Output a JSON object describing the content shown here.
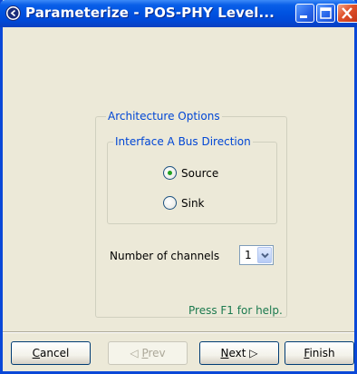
{
  "window": {
    "title": "Parameterize - POS-PHY Level..."
  },
  "titlebar": {
    "buttons": [
      {
        "name": "minimize",
        "icon": "minimize-icon"
      },
      {
        "name": "maximize",
        "icon": "maximize-icon"
      },
      {
        "name": "close",
        "icon": "close-icon"
      }
    ],
    "app_icon": "app-icon"
  },
  "architecture": {
    "group_label": "Architecture Options",
    "interface": {
      "group_label": "Interface A Bus Direction",
      "options": [
        {
          "label": "Source",
          "selected": true
        },
        {
          "label": "Sink",
          "selected": false
        }
      ]
    },
    "channels": {
      "label": "Number of channels",
      "value": "1"
    }
  },
  "help": {
    "text": "Press F1 for help."
  },
  "buttons": {
    "cancel": {
      "mnemonic": "C",
      "rest": "ancel",
      "enabled": true
    },
    "prev": {
      "arrow": "◁",
      "mnemonic": "P",
      "rest": "rev",
      "enabled": false
    },
    "next": {
      "mnemonic": "N",
      "rest": "ext",
      "arrow": "▷",
      "enabled": true
    },
    "finish": {
      "mnemonic": "F",
      "rest": "inish",
      "enabled": true
    }
  },
  "colors": {
    "titlebar": "#0053e1",
    "group_label": "#0046d5",
    "help_text": "#1c7a4f",
    "radio_selected": "#21a121",
    "close_button": "#e0512a"
  }
}
